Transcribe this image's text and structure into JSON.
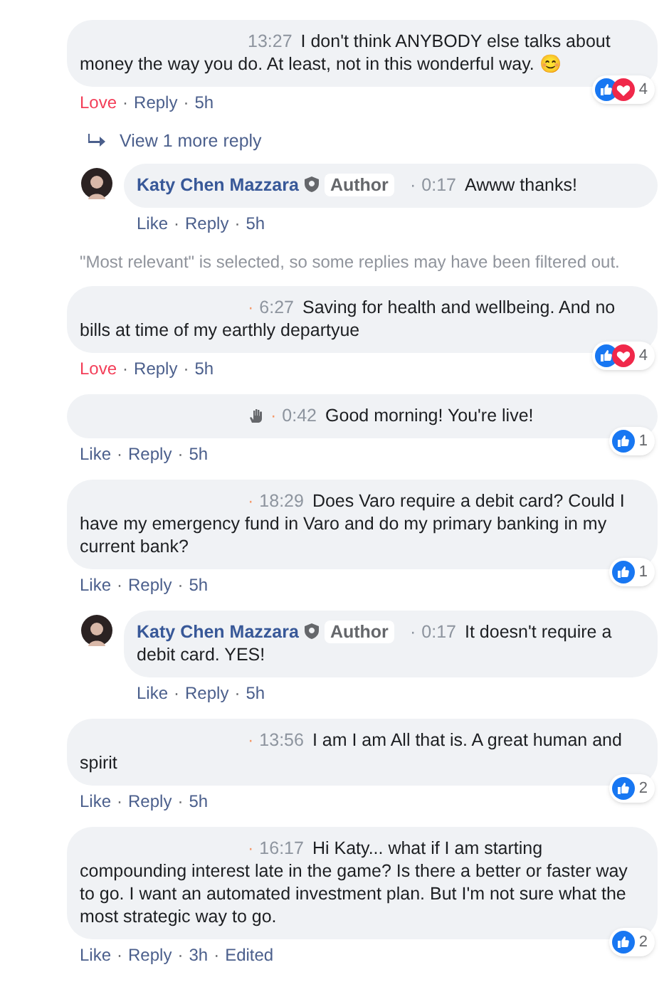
{
  "comments": [
    {
      "kind": "comment",
      "time": "13:27",
      "text": "I don't think ANYBODY else talks about money the way you do. At least, not in this wonderful way. 😊",
      "hand_badge": false,
      "reactions": {
        "like": true,
        "love": true,
        "count": "4"
      },
      "action": {
        "label": "Love",
        "reacted": true
      },
      "separator": "·",
      "reply": "Reply",
      "age": "5h"
    },
    {
      "kind": "more",
      "text": "View 1 more reply"
    },
    {
      "kind": "reply",
      "name": "Katy Chen Mazzara",
      "badge": "Author",
      "dot": "·",
      "time": "0:17",
      "text": "Awww thanks!",
      "action": {
        "label": "Like",
        "reacted": false
      },
      "separator": "·",
      "reply": "Reply",
      "age": "5h"
    },
    {
      "kind": "notice",
      "text": "\"Most relevant\" is selected, so some replies may have been filtered out."
    },
    {
      "kind": "comment",
      "dot": "·",
      "time": "6:27",
      "text": "Saving for health and wellbeing. And no bills at time of my earthly departyue",
      "hand_badge": false,
      "reactions": {
        "like": true,
        "love": true,
        "count": "4"
      },
      "action": {
        "label": "Love",
        "reacted": true
      },
      "separator": "·",
      "reply": "Reply",
      "age": "5h"
    },
    {
      "kind": "comment",
      "dot": "·",
      "time": "0:42",
      "text": "Good morning! You're live!",
      "hand_badge": true,
      "reactions": {
        "like": true,
        "love": false,
        "count": "1"
      },
      "action": {
        "label": "Like",
        "reacted": false
      },
      "separator": "·",
      "reply": "Reply",
      "age": "5h"
    },
    {
      "kind": "comment",
      "dot": "·",
      "time": "18:29",
      "text": "Does Varo require a debit card? Could I have my emergency fund in Varo and do my primary banking in my current bank?",
      "hand_badge": false,
      "reactions": {
        "like": true,
        "love": false,
        "count": "1"
      },
      "action": {
        "label": "Like",
        "reacted": false
      },
      "separator": "·",
      "reply": "Reply",
      "age": "5h"
    },
    {
      "kind": "reply",
      "name": "Katy Chen Mazzara",
      "badge": "Author",
      "dot": "·",
      "time": "0:17",
      "text": "It doesn't require a debit card. YES!",
      "action": {
        "label": "Like",
        "reacted": false
      },
      "separator": "·",
      "reply": "Reply",
      "age": "5h"
    },
    {
      "kind": "comment",
      "dot": "·",
      "time": "13:56",
      "text": "I am I am All that is. A great human and spirit",
      "hand_badge": false,
      "reactions": {
        "like": true,
        "love": false,
        "count": "2"
      },
      "action": {
        "label": "Like",
        "reacted": false
      },
      "separator": "·",
      "reply": "Reply",
      "age": "5h"
    },
    {
      "kind": "comment",
      "dot": "·",
      "time": "16:17",
      "text": "Hi Katy... what if I am starting compounding interest late in the game? Is there a better or faster way to go. I want an automated investment plan. But I'm not sure what the most strategic way to go.",
      "hand_badge": false,
      "reactions": {
        "like": true,
        "love": false,
        "count": "2"
      },
      "action": {
        "label": "Like",
        "reacted": false
      },
      "separator": "·",
      "reply": "Reply",
      "age": "3h",
      "edited": "Edited"
    }
  ]
}
